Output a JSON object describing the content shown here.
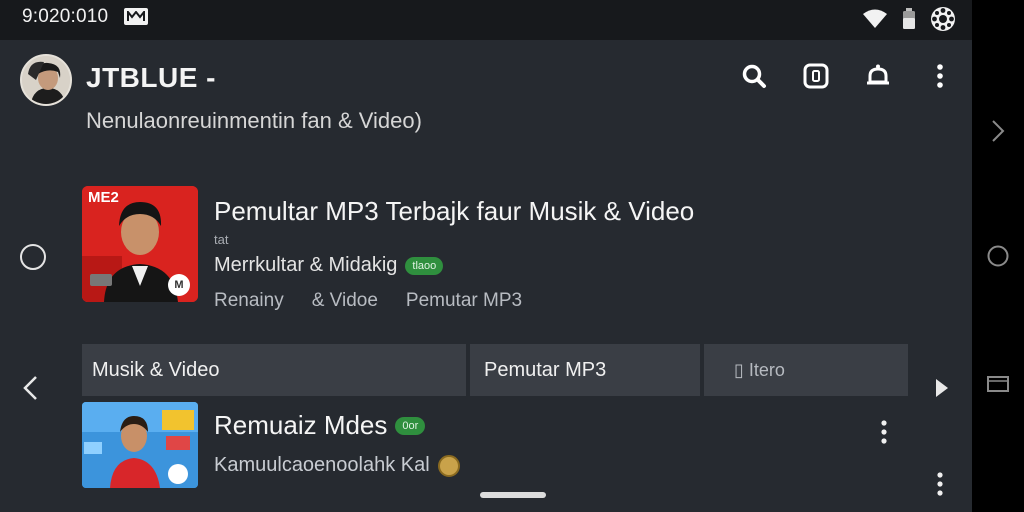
{
  "status_bar": {
    "time": "9:020:010",
    "cast_icon": "cast-icon",
    "wifi_icon": "wifi-icon",
    "battery_icon": "battery-icon",
    "settings_icon": "gear-icon"
  },
  "header": {
    "title": "JTBLUE -",
    "subtitle": "Nenulaonreuinmentin  fan   & Video)",
    "actions": [
      "search-icon",
      "cast-square-icon",
      "notification-bell-icon",
      "more-vert-icon"
    ]
  },
  "featured": {
    "thumb_label": "ME2",
    "thumb_badge": "M",
    "title": "Pemultar MP3 Terbajk faur Musik & Video",
    "sub": "tat",
    "line2": "Merrkultar & Midakig",
    "badge": "tlaoo",
    "tags": [
      "Renainy",
      "& Vidoe",
      "Pemutar MP3"
    ]
  },
  "tabs": [
    {
      "label": "Musik & Video"
    },
    {
      "label": "Pemutar MP3"
    },
    {
      "label": "▯ Itero"
    }
  ],
  "second_item": {
    "title": "Remuaiz Mdes",
    "badge": "0or",
    "subtitle": "Kamuulcaoenoolahk Kal"
  },
  "colors": {
    "app_bg": "#262a30",
    "status_bg": "#17191c",
    "tab_bg": "#3a3e45",
    "badge_green": "#2f8f3e",
    "thumb_red": "#d8221f"
  }
}
